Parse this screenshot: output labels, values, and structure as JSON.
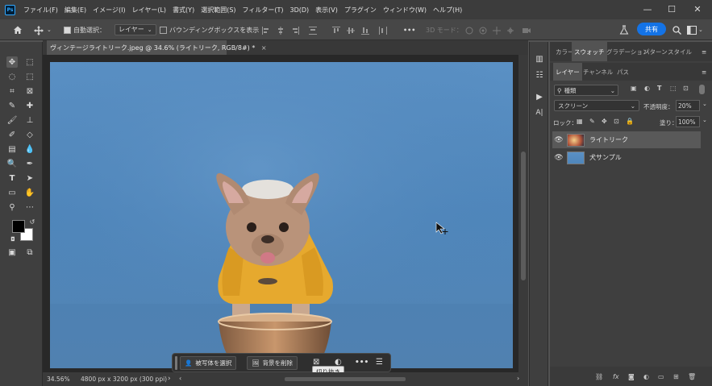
{
  "menubar": {
    "logo": "Ps",
    "items": [
      "ファイル(F)",
      "編集(E)",
      "イメージ(I)",
      "レイヤー(L)",
      "書式(Y)",
      "選択範囲(S)",
      "フィルター(T)",
      "3D(D)",
      "表示(V)",
      "プラグイン",
      "ウィンドウ(W)",
      "ヘルプ(H)"
    ],
    "minimize": "—",
    "maximize": "☐",
    "close": "✕"
  },
  "options": {
    "auto_select_label": "自動選択：",
    "auto_select_value": "レイヤー",
    "bounding_box_label": "バウンディングボックスを表示",
    "more": "•••",
    "mode_3d": "3D モード：",
    "share": "共有"
  },
  "document": {
    "tab_title": "ヴィンテージライトリーク.jpeg @ 34.6% (ライトリーク, RGB/8#) *",
    "tab_close": "×"
  },
  "status": {
    "zoom": "34.56%",
    "dimensions": "4800 px x 3200 px (300 ppi)",
    "arrow": "›"
  },
  "context_bar": {
    "select_subject": "被写体を選択",
    "remove_bg": "背景を削除",
    "more": "•••",
    "tooltip": "切り抜き"
  },
  "panels": {
    "top_tabs": [
      "カラー",
      "スウォッチ",
      "グラデーション",
      "パターン",
      "スタイル"
    ],
    "active_top_tab": "スウォッチ",
    "layer_tabs": [
      "レイヤー",
      "チャンネル",
      "パス"
    ],
    "active_layer_tab": "レイヤー",
    "filter_kind": "種類",
    "blend_mode": "スクリーン",
    "opacity_label": "不透明度：",
    "opacity_value": "20%",
    "lock_label": "ロック：",
    "fill_label": "塗り：",
    "fill_value": "100%",
    "layers": [
      {
        "name": "ライトリーク",
        "active": true
      },
      {
        "name": "犬サンプル",
        "active": false
      }
    ],
    "bottom_icons": [
      "link",
      "fx",
      "mask",
      "adjust",
      "group",
      "new",
      "delete"
    ]
  },
  "colors": {
    "accent": "#1473e6",
    "canvas_bg": "#5a90c4",
    "dog_sweater": "#e6a92e",
    "bowl": "#b5835e"
  }
}
